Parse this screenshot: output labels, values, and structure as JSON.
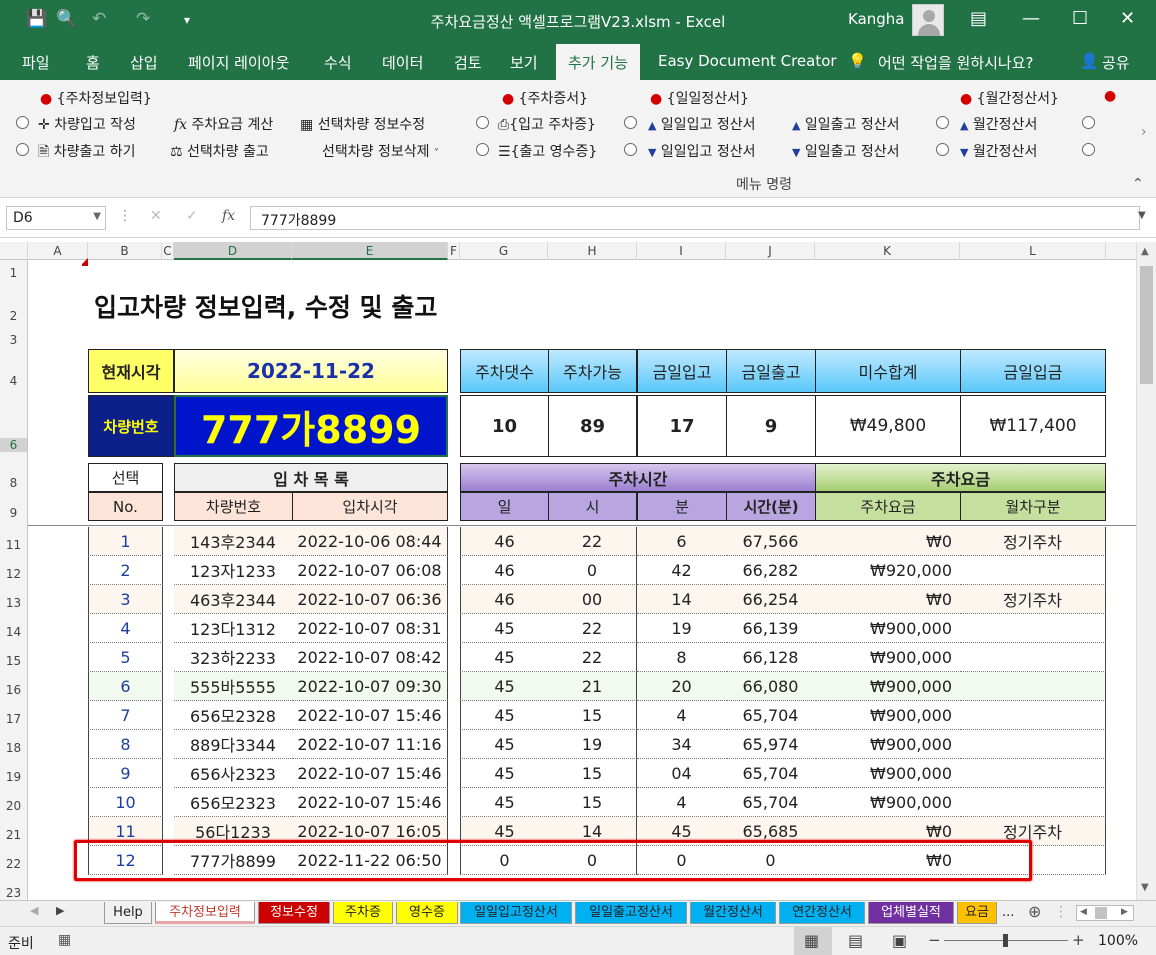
{
  "window": {
    "title": "주차요금정산 액셀프로그램V23.xlsm  -  Excel",
    "user": "Kangha"
  },
  "ribbon_tabs": [
    "파일",
    "홈",
    "삽입",
    "페이지 레이아웃",
    "수식",
    "데이터",
    "검토",
    "보기",
    "추가 기능",
    "Easy Document Creator",
    "어떤 작업을 원하시나요?",
    "공유"
  ],
  "ribbon": {
    "g1_header": "{주차정보입력}",
    "g1_r1a": "차량입고 작성",
    "g1_r1b": "주차요금 계산",
    "g1_r1c": "선택차량 정보수정",
    "g1_r2a": "차량출고 하기",
    "g1_r2b": "선택차량 출고",
    "g1_r2c": "선택차량 정보삭제",
    "g2_header": "{주차증서}",
    "g2_r1": "{입고 주차증}",
    "g2_r2": "{출고 영수증}",
    "g3_header": "{일일정산서}",
    "g3_r1a": "일일입고 정산서",
    "g3_r1b": "일일출고 정산서",
    "g3_r2a": "일일입고 정산서",
    "g3_r2b": "일일출고 정산서",
    "g4_header": "{월간정산서}",
    "g4_r1": "월간정산서",
    "g4_r2": "월간정산서",
    "group_label": "메뉴 명령"
  },
  "formula_bar": {
    "name_box": "D6",
    "value": "777가8899"
  },
  "columns": [
    "A",
    "B",
    "C",
    "D",
    "E",
    "F",
    "G",
    "H",
    "I",
    "J",
    "K",
    "L"
  ],
  "rows": [
    "1",
    "2",
    "3",
    "4",
    "6",
    "8",
    "9",
    "11",
    "12",
    "13",
    "14",
    "15",
    "16",
    "17",
    "18",
    "19",
    "20",
    "21",
    "22",
    "23"
  ],
  "sheet": {
    "title": "입고차량 정보입력, 수정 및 출고",
    "now_label": "현재시각",
    "now_value": "2022-11-22",
    "car_label": "차량번호",
    "car_value": "777가8899",
    "summary_headers": [
      "주차댓수",
      "주차가능",
      "금일입고",
      "금일출고",
      "미수합계",
      "금일입금"
    ],
    "summary_values": [
      "10",
      "89",
      "17",
      "9",
      "₩49,800",
      "₩117,400"
    ],
    "hdr_select": "선택",
    "hdr_no": "No.",
    "hdr_list": "입 차 목 록",
    "hdr_car": "차량번호",
    "hdr_time": "입차시각",
    "hdr_parktime": "주차시간",
    "hdr_day": "일",
    "hdr_hour": "시",
    "hdr_min": "분",
    "hdr_minutes": "시간(분)",
    "hdr_fee": "주차요금",
    "hdr_fee2": "주차요금",
    "hdr_month": "월차구분"
  },
  "table": [
    {
      "no": "1",
      "car": "143후2344",
      "time": "2022-10-06 08:44",
      "d": "46",
      "h": "22",
      "m": "6",
      "min": "67,566",
      "fee": "₩0",
      "type": "정기주차"
    },
    {
      "no": "2",
      "car": "123자1233",
      "time": "2022-10-07 06:08",
      "d": "46",
      "h": "0",
      "m": "42",
      "min": "66,282",
      "fee": "₩920,000",
      "type": ""
    },
    {
      "no": "3",
      "car": "463후2344",
      "time": "2022-10-07 06:36",
      "d": "46",
      "h": "00",
      "m": "14",
      "min": "66,254",
      "fee": "₩0",
      "type": "정기주차"
    },
    {
      "no": "4",
      "car": "123다1312",
      "time": "2022-10-07 08:31",
      "d": "45",
      "h": "22",
      "m": "19",
      "min": "66,139",
      "fee": "₩900,000",
      "type": ""
    },
    {
      "no": "5",
      "car": "323하2233",
      "time": "2022-10-07 08:42",
      "d": "45",
      "h": "22",
      "m": "8",
      "min": "66,128",
      "fee": "₩900,000",
      "type": ""
    },
    {
      "no": "6",
      "car": "555바5555",
      "time": "2022-10-07 09:30",
      "d": "45",
      "h": "21",
      "m": "20",
      "min": "66,080",
      "fee": "₩900,000",
      "type": ""
    },
    {
      "no": "7",
      "car": "656모2328",
      "time": "2022-10-07 15:46",
      "d": "45",
      "h": "15",
      "m": "4",
      "min": "65,704",
      "fee": "₩900,000",
      "type": ""
    },
    {
      "no": "8",
      "car": "889다3344",
      "time": "2022-10-07 11:16",
      "d": "45",
      "h": "19",
      "m": "34",
      "min": "65,974",
      "fee": "₩900,000",
      "type": ""
    },
    {
      "no": "9",
      "car": "656사2323",
      "time": "2022-10-07 15:46",
      "d": "45",
      "h": "15",
      "m": "04",
      "min": "65,704",
      "fee": "₩900,000",
      "type": ""
    },
    {
      "no": "10",
      "car": "656모2323",
      "time": "2022-10-07 15:46",
      "d": "45",
      "h": "15",
      "m": "4",
      "min": "65,704",
      "fee": "₩900,000",
      "type": ""
    },
    {
      "no": "11",
      "car": "56다1233",
      "time": "2022-10-07 16:05",
      "d": "45",
      "h": "14",
      "m": "45",
      "min": "65,685",
      "fee": "₩0",
      "type": "정기주차"
    },
    {
      "no": "12",
      "car": "777가8899",
      "time": "2022-11-22 06:50",
      "d": "0",
      "h": "0",
      "m": "0",
      "min": "0",
      "fee": "₩0",
      "type": ""
    }
  ],
  "sheet_tabs": [
    "Help",
    "주차정보입력",
    "정보수정",
    "주차증",
    "영수증",
    "일일입고정산서",
    "일일출고정산서",
    "월간정산서",
    "연간정산서",
    "업체별실적",
    "요금",
    "..."
  ],
  "status": {
    "ready": "준비",
    "zoom": "100%"
  }
}
